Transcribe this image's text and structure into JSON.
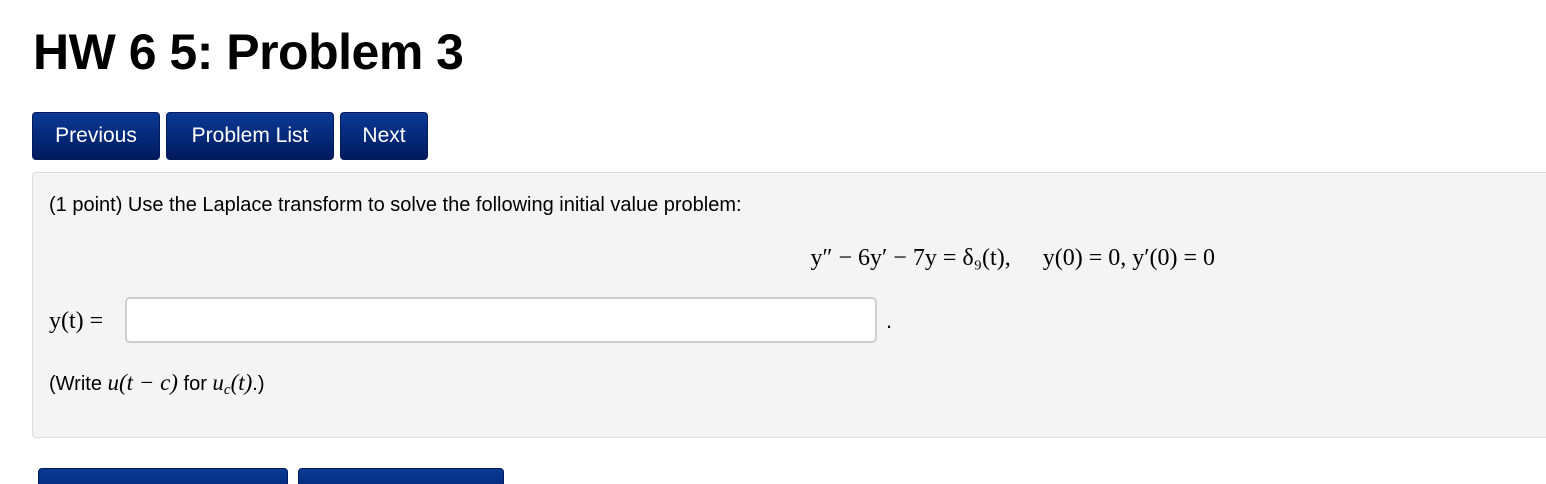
{
  "page": {
    "title": "HW 6 5: Problem 3"
  },
  "nav": {
    "previous_label": "Previous",
    "problem_list_label": "Problem List",
    "next_label": "Next"
  },
  "problem": {
    "intro": "(1 point) Use the Laplace transform to solve the following initial value problem:",
    "equation": "y″ − 6y′ − 7y = δ₉(t),",
    "initial_conditions": "y(0) = 0,  y′(0) = 0",
    "answer_label": "y(t) =",
    "answer_value": "",
    "answer_suffix": ".",
    "hint_prefix": "(Write ",
    "hint_expr": "u(t − c)",
    "hint_middle": " for ",
    "hint_func": "u",
    "hint_sub": "c",
    "hint_arg": "(t)",
    "hint_suffix": ".)"
  },
  "colors": {
    "button_bg": "#022a78",
    "panel_bg": "#f4f4f4",
    "panel_border": "#dcdcdc"
  }
}
